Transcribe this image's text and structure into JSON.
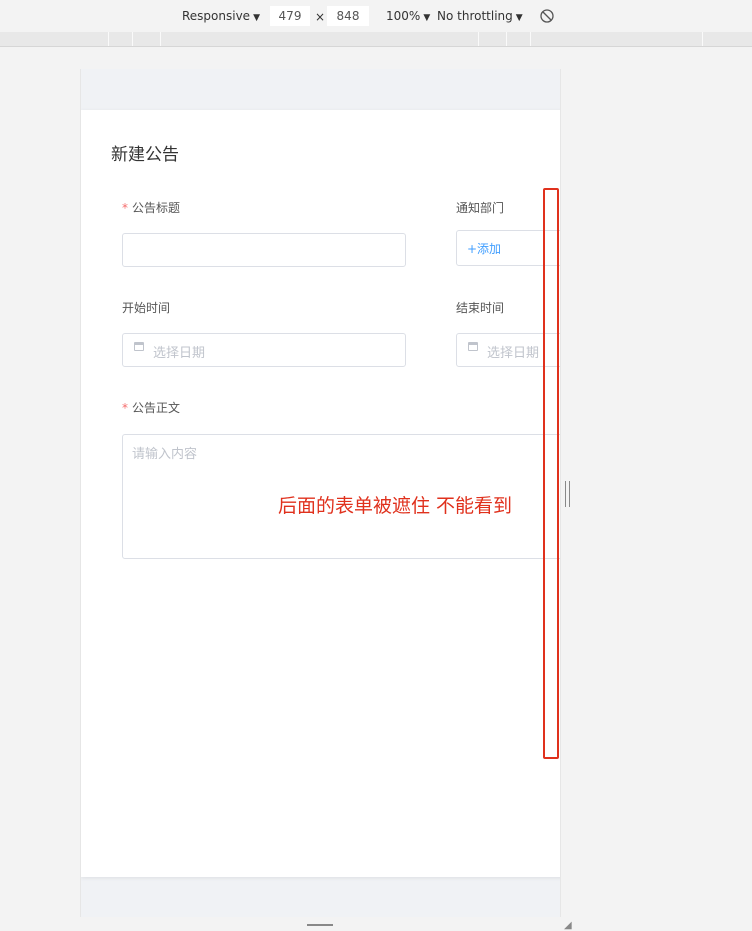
{
  "devtools": {
    "device_mode": "Responsive",
    "width": "479",
    "times": "×",
    "height": "848",
    "zoom": "100%",
    "throttling": "No throttling",
    "rotate_icon": "rotate-icon"
  },
  "form": {
    "title": "新建公告",
    "required_mark": "*",
    "notice_title_label": "公告标题",
    "notify_dept_label": "通知部门",
    "add_link": "+添加",
    "start_time_label": "开始时间",
    "end_time_label": "结束时间",
    "date_placeholder": "选择日期",
    "body_label": "公告正文",
    "body_placeholder": "请输入内容"
  },
  "annotation": {
    "text": "后面的表单被遮住 不能看到",
    "color": "#e0311d"
  },
  "colors": {
    "accent": "#409eff",
    "required": "#f56c6c"
  }
}
